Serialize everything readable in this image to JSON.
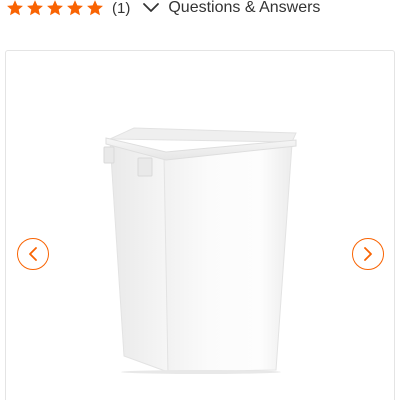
{
  "rating": {
    "stars_filled": 5,
    "stars_total": 5,
    "star_color": "#f96302",
    "review_count": "(1)"
  },
  "qa": {
    "label": "Questions & Answers",
    "icon": "chevron-down-icon"
  },
  "gallery": {
    "image_subject": "white-rectangular-trash-can",
    "prev_icon": "chevron-left-icon",
    "next_icon": "chevron-right-icon",
    "accent_color": "#f96302"
  }
}
